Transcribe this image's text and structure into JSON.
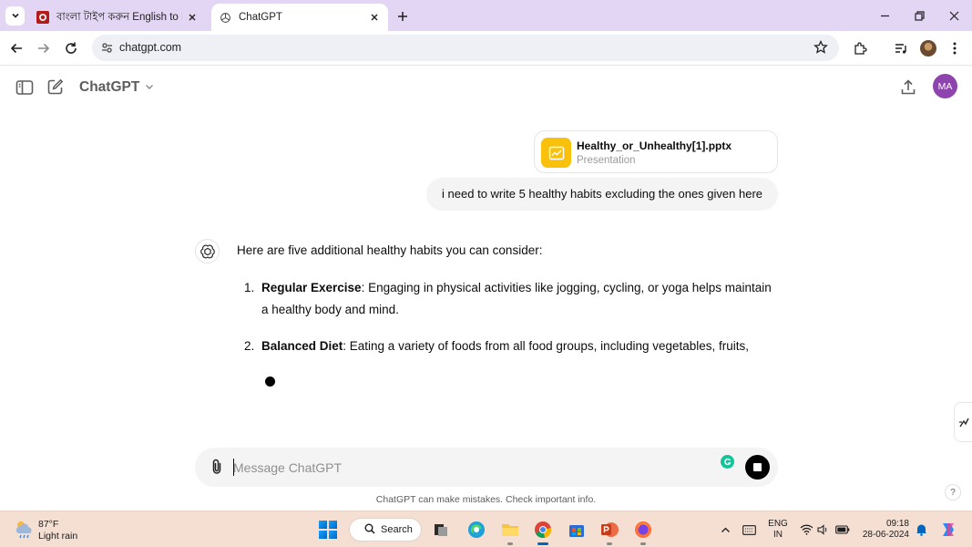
{
  "browser": {
    "tabs": [
      {
        "title": "বাংলা টাইপ করুন English to Bengali",
        "active": false
      },
      {
        "title": "ChatGPT",
        "active": true
      }
    ],
    "url": "chatgpt.com"
  },
  "header": {
    "model": "ChatGPT",
    "avatar_initials": "MA"
  },
  "conversation": {
    "attachment": {
      "name": "Healthy_or_Unhealthy[1].pptx",
      "type": "Presentation"
    },
    "user_message": "i need to write 5 healthy habits excluding the ones given here",
    "assistant": {
      "intro": "Here are five additional healthy habits you can consider:",
      "habits": [
        {
          "num": "1.",
          "term": "Regular Exercise",
          "text": ": Engaging in physical activities like jogging, cycling, or yoga helps maintain a healthy body and mind."
        },
        {
          "num": "2.",
          "term": "Balanced Diet",
          "text": ": Eating a variety of foods from all food groups, including vegetables, fruits,"
        }
      ]
    }
  },
  "composer": {
    "placeholder": "Message ChatGPT",
    "disclaimer": "ChatGPT can make mistakes. Check important info.",
    "help": "?"
  },
  "taskbar": {
    "weather_temp": "87°F",
    "weather_desc": "Light rain",
    "search_label": "Search",
    "lang_line1": "ENG",
    "lang_line2": "IN",
    "time": "09:18",
    "date": "28-06-2024"
  },
  "colors": {
    "tab_strip": "#e3d6f5",
    "avatar": "#8e44ad",
    "file_icon": "#f9c00c",
    "taskbar": "#f4dfd2"
  },
  "icons": [
    "tab-search-icon",
    "close-icon",
    "new-tab-icon",
    "minimize-icon",
    "restore-icon",
    "back-icon",
    "forward-icon",
    "reload-icon",
    "site-info-icon",
    "bookmark-star-icon",
    "extensions-icon",
    "media-control-icon",
    "menu-dots-icon",
    "sidebar-toggle-icon",
    "new-chat-icon",
    "chevron-down-icon",
    "share-icon",
    "openai-logo-icon",
    "paperclip-icon",
    "stop-icon"
  ]
}
